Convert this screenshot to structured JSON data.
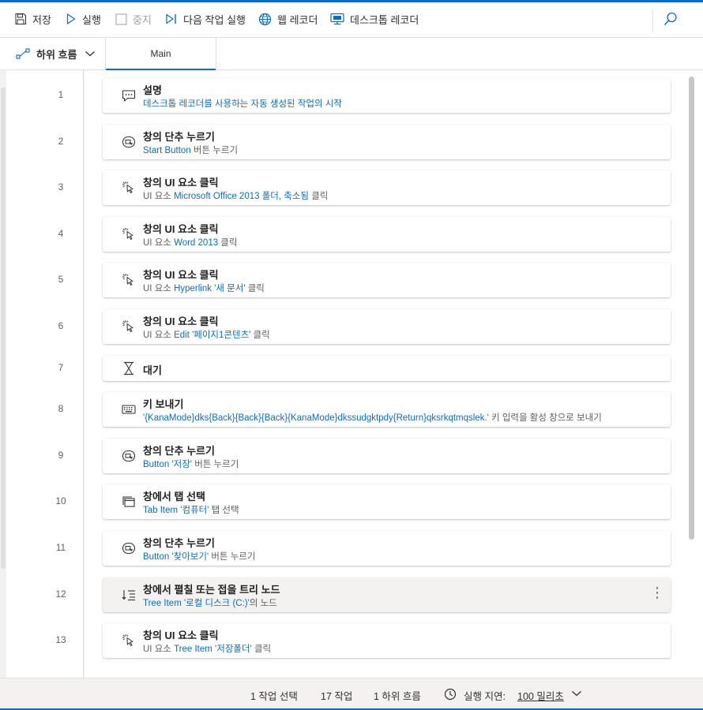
{
  "toolbar": {
    "save": "저장",
    "run": "실행",
    "stop": "중지",
    "run_next": "다음 작업 실행",
    "web_recorder": "웹 레코더",
    "desktop_recorder": "데스크톱 레코더"
  },
  "subflow": {
    "label": "하위 흐름"
  },
  "tabs": {
    "main": "Main"
  },
  "steps": [
    {
      "line": "1",
      "icon": "comment-icon",
      "title": "설명",
      "desc": [
        {
          "t": "데스크톱 레코더를 사용하는 자동 생성된 작업의 시작",
          "hl": true
        }
      ]
    },
    {
      "line": "2",
      "icon": "press-button-icon",
      "title": "창의 단추 누르기",
      "desc": [
        {
          "t": "Start Button",
          "hl": true
        },
        {
          "t": " 버튼 누르기",
          "hl": false
        }
      ]
    },
    {
      "line": "3",
      "icon": "click-icon",
      "title": "창의 UI 요소 클릭",
      "desc": [
        {
          "t": "UI 요소 ",
          "hl": false
        },
        {
          "t": "Microsoft Office 2013 폴더, 축소됨",
          "hl": true
        },
        {
          "t": " 클릭",
          "hl": false
        }
      ]
    },
    {
      "line": "4",
      "icon": "click-icon",
      "title": "창의 UI 요소 클릭",
      "desc": [
        {
          "t": "UI 요소 ",
          "hl": false
        },
        {
          "t": "Word 2013",
          "hl": true
        },
        {
          "t": " 클릭",
          "hl": false
        }
      ]
    },
    {
      "line": "5",
      "icon": "click-icon",
      "title": "창의 UI 요소 클릭",
      "desc": [
        {
          "t": "UI 요소 ",
          "hl": false
        },
        {
          "t": "Hyperlink '새 문서'",
          "hl": true
        },
        {
          "t": " 클릭",
          "hl": false
        }
      ]
    },
    {
      "line": "6",
      "icon": "click-icon",
      "title": "창의 UI 요소 클릭",
      "desc": [
        {
          "t": "UI 요소 ",
          "hl": false
        },
        {
          "t": "Edit '페이지1콘텐츠'",
          "hl": true
        },
        {
          "t": " 클릭",
          "hl": false
        }
      ]
    },
    {
      "line": "7",
      "icon": "hourglass-icon",
      "title": "대기",
      "desc": []
    },
    {
      "line": "8",
      "icon": "keyboard-icon",
      "title": "키 보내기",
      "desc": [
        {
          "t": "'{KanaMode}dks{Back}{Back}{Back}{KanaMode}dkssudgktpdy{Return}qksrkqtmqslek.'",
          "hl": true
        },
        {
          "t": " 키 입력을 활성 창으로 보내기",
          "hl": false
        }
      ]
    },
    {
      "line": "9",
      "icon": "press-button-icon",
      "title": "창의 단추 누르기",
      "desc": [
        {
          "t": "Button '저장'",
          "hl": true
        },
        {
          "t": " 버튼 누르기",
          "hl": false
        }
      ]
    },
    {
      "line": "10",
      "icon": "tab-select-icon",
      "title": "창에서 탭 선택",
      "desc": [
        {
          "t": "Tab Item '컴퓨터'",
          "hl": true
        },
        {
          "t": " 탭 선택",
          "hl": false
        }
      ]
    },
    {
      "line": "11",
      "icon": "press-button-icon",
      "title": "창의 단추 누르기",
      "desc": [
        {
          "t": "Button '찾아보기'",
          "hl": true
        },
        {
          "t": " 버튼 누르기",
          "hl": false
        }
      ]
    },
    {
      "line": "12",
      "icon": "tree-node-icon",
      "title": "창에서 펼칠 또는 접을 트리 노드",
      "desc": [
        {
          "t": "Tree Item '로컬 디스크 (C:)'",
          "hl": true
        },
        {
          "t": "의  노드",
          "hl": false
        }
      ],
      "selected": true
    },
    {
      "line": "13",
      "icon": "click-icon",
      "title": "창의 UI 요소 클릭",
      "desc": [
        {
          "t": "UI 요소 ",
          "hl": false
        },
        {
          "t": "Tree Item '저장폴더'",
          "hl": true
        },
        {
          "t": " 클릭",
          "hl": false
        }
      ]
    }
  ],
  "status": {
    "selected": "1 작업 선택",
    "actions": "17 작업",
    "subflows": "1 하위 흐름",
    "delay_label": "실행 지연:",
    "delay_value": "100 밀리초"
  },
  "colors": {
    "accent": "#0f6cbd",
    "disabled": "#a19f9d"
  }
}
